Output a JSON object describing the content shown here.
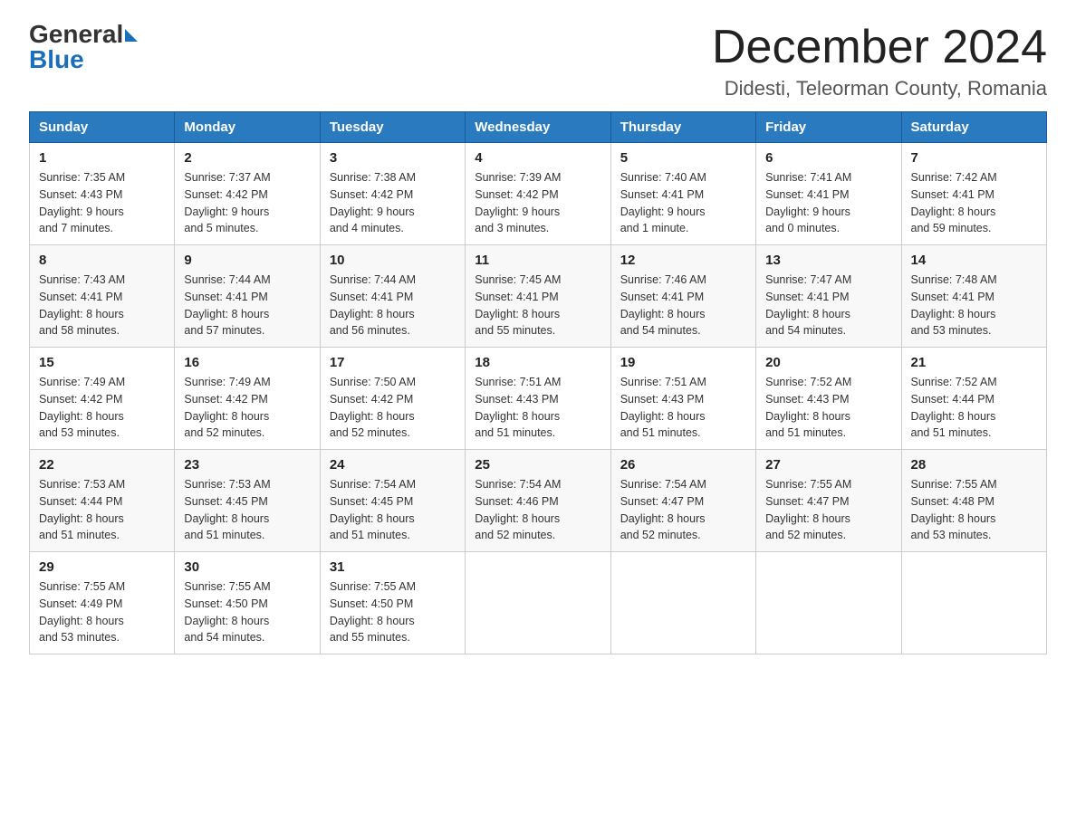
{
  "header": {
    "logo_general": "General",
    "logo_blue": "Blue",
    "month_title": "December 2024",
    "location": "Didesti, Teleorman County, Romania"
  },
  "days_of_week": [
    "Sunday",
    "Monday",
    "Tuesday",
    "Wednesday",
    "Thursday",
    "Friday",
    "Saturday"
  ],
  "weeks": [
    [
      {
        "day": "1",
        "sunrise": "Sunrise: 7:35 AM",
        "sunset": "Sunset: 4:43 PM",
        "daylight": "Daylight: 9 hours",
        "daylight2": "and 7 minutes."
      },
      {
        "day": "2",
        "sunrise": "Sunrise: 7:37 AM",
        "sunset": "Sunset: 4:42 PM",
        "daylight": "Daylight: 9 hours",
        "daylight2": "and 5 minutes."
      },
      {
        "day": "3",
        "sunrise": "Sunrise: 7:38 AM",
        "sunset": "Sunset: 4:42 PM",
        "daylight": "Daylight: 9 hours",
        "daylight2": "and 4 minutes."
      },
      {
        "day": "4",
        "sunrise": "Sunrise: 7:39 AM",
        "sunset": "Sunset: 4:42 PM",
        "daylight": "Daylight: 9 hours",
        "daylight2": "and 3 minutes."
      },
      {
        "day": "5",
        "sunrise": "Sunrise: 7:40 AM",
        "sunset": "Sunset: 4:41 PM",
        "daylight": "Daylight: 9 hours",
        "daylight2": "and 1 minute."
      },
      {
        "day": "6",
        "sunrise": "Sunrise: 7:41 AM",
        "sunset": "Sunset: 4:41 PM",
        "daylight": "Daylight: 9 hours",
        "daylight2": "and 0 minutes."
      },
      {
        "day": "7",
        "sunrise": "Sunrise: 7:42 AM",
        "sunset": "Sunset: 4:41 PM",
        "daylight": "Daylight: 8 hours",
        "daylight2": "and 59 minutes."
      }
    ],
    [
      {
        "day": "8",
        "sunrise": "Sunrise: 7:43 AM",
        "sunset": "Sunset: 4:41 PM",
        "daylight": "Daylight: 8 hours",
        "daylight2": "and 58 minutes."
      },
      {
        "day": "9",
        "sunrise": "Sunrise: 7:44 AM",
        "sunset": "Sunset: 4:41 PM",
        "daylight": "Daylight: 8 hours",
        "daylight2": "and 57 minutes."
      },
      {
        "day": "10",
        "sunrise": "Sunrise: 7:44 AM",
        "sunset": "Sunset: 4:41 PM",
        "daylight": "Daylight: 8 hours",
        "daylight2": "and 56 minutes."
      },
      {
        "day": "11",
        "sunrise": "Sunrise: 7:45 AM",
        "sunset": "Sunset: 4:41 PM",
        "daylight": "Daylight: 8 hours",
        "daylight2": "and 55 minutes."
      },
      {
        "day": "12",
        "sunrise": "Sunrise: 7:46 AM",
        "sunset": "Sunset: 4:41 PM",
        "daylight": "Daylight: 8 hours",
        "daylight2": "and 54 minutes."
      },
      {
        "day": "13",
        "sunrise": "Sunrise: 7:47 AM",
        "sunset": "Sunset: 4:41 PM",
        "daylight": "Daylight: 8 hours",
        "daylight2": "and 54 minutes."
      },
      {
        "day": "14",
        "sunrise": "Sunrise: 7:48 AM",
        "sunset": "Sunset: 4:41 PM",
        "daylight": "Daylight: 8 hours",
        "daylight2": "and 53 minutes."
      }
    ],
    [
      {
        "day": "15",
        "sunrise": "Sunrise: 7:49 AM",
        "sunset": "Sunset: 4:42 PM",
        "daylight": "Daylight: 8 hours",
        "daylight2": "and 53 minutes."
      },
      {
        "day": "16",
        "sunrise": "Sunrise: 7:49 AM",
        "sunset": "Sunset: 4:42 PM",
        "daylight": "Daylight: 8 hours",
        "daylight2": "and 52 minutes."
      },
      {
        "day": "17",
        "sunrise": "Sunrise: 7:50 AM",
        "sunset": "Sunset: 4:42 PM",
        "daylight": "Daylight: 8 hours",
        "daylight2": "and 52 minutes."
      },
      {
        "day": "18",
        "sunrise": "Sunrise: 7:51 AM",
        "sunset": "Sunset: 4:43 PM",
        "daylight": "Daylight: 8 hours",
        "daylight2": "and 51 minutes."
      },
      {
        "day": "19",
        "sunrise": "Sunrise: 7:51 AM",
        "sunset": "Sunset: 4:43 PM",
        "daylight": "Daylight: 8 hours",
        "daylight2": "and 51 minutes."
      },
      {
        "day": "20",
        "sunrise": "Sunrise: 7:52 AM",
        "sunset": "Sunset: 4:43 PM",
        "daylight": "Daylight: 8 hours",
        "daylight2": "and 51 minutes."
      },
      {
        "day": "21",
        "sunrise": "Sunrise: 7:52 AM",
        "sunset": "Sunset: 4:44 PM",
        "daylight": "Daylight: 8 hours",
        "daylight2": "and 51 minutes."
      }
    ],
    [
      {
        "day": "22",
        "sunrise": "Sunrise: 7:53 AM",
        "sunset": "Sunset: 4:44 PM",
        "daylight": "Daylight: 8 hours",
        "daylight2": "and 51 minutes."
      },
      {
        "day": "23",
        "sunrise": "Sunrise: 7:53 AM",
        "sunset": "Sunset: 4:45 PM",
        "daylight": "Daylight: 8 hours",
        "daylight2": "and 51 minutes."
      },
      {
        "day": "24",
        "sunrise": "Sunrise: 7:54 AM",
        "sunset": "Sunset: 4:45 PM",
        "daylight": "Daylight: 8 hours",
        "daylight2": "and 51 minutes."
      },
      {
        "day": "25",
        "sunrise": "Sunrise: 7:54 AM",
        "sunset": "Sunset: 4:46 PM",
        "daylight": "Daylight: 8 hours",
        "daylight2": "and 52 minutes."
      },
      {
        "day": "26",
        "sunrise": "Sunrise: 7:54 AM",
        "sunset": "Sunset: 4:47 PM",
        "daylight": "Daylight: 8 hours",
        "daylight2": "and 52 minutes."
      },
      {
        "day": "27",
        "sunrise": "Sunrise: 7:55 AM",
        "sunset": "Sunset: 4:47 PM",
        "daylight": "Daylight: 8 hours",
        "daylight2": "and 52 minutes."
      },
      {
        "day": "28",
        "sunrise": "Sunrise: 7:55 AM",
        "sunset": "Sunset: 4:48 PM",
        "daylight": "Daylight: 8 hours",
        "daylight2": "and 53 minutes."
      }
    ],
    [
      {
        "day": "29",
        "sunrise": "Sunrise: 7:55 AM",
        "sunset": "Sunset: 4:49 PM",
        "daylight": "Daylight: 8 hours",
        "daylight2": "and 53 minutes."
      },
      {
        "day": "30",
        "sunrise": "Sunrise: 7:55 AM",
        "sunset": "Sunset: 4:50 PM",
        "daylight": "Daylight: 8 hours",
        "daylight2": "and 54 minutes."
      },
      {
        "day": "31",
        "sunrise": "Sunrise: 7:55 AM",
        "sunset": "Sunset: 4:50 PM",
        "daylight": "Daylight: 8 hours",
        "daylight2": "and 55 minutes."
      },
      null,
      null,
      null,
      null
    ]
  ]
}
